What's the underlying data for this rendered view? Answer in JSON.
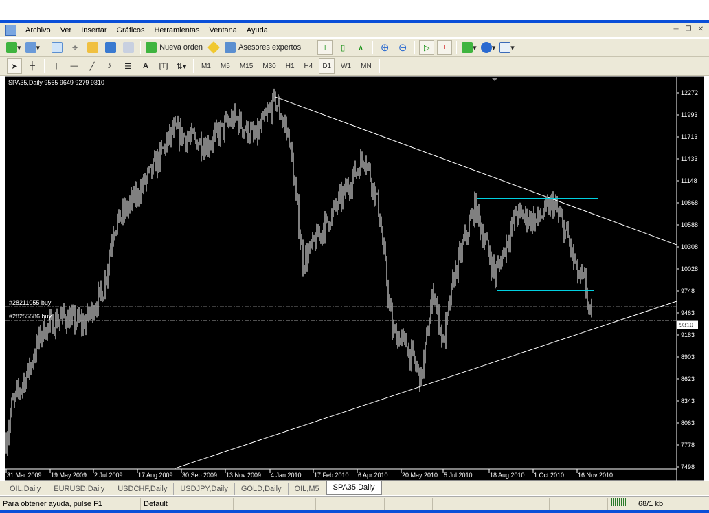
{
  "menu": [
    "Archivo",
    "Ver",
    "Insertar",
    "Gráficos",
    "Herramientas",
    "Ventana",
    "Ayuda"
  ],
  "toolbar": {
    "new_order": "Nueva orden",
    "experts": "Asesores expertos"
  },
  "timeframes": [
    "M1",
    "M5",
    "M15",
    "M30",
    "H1",
    "H4",
    "D1",
    "W1",
    "MN"
  ],
  "active_timeframe": "D1",
  "chart": {
    "header": "SPA35,Daily  9565 9649 9279 9310",
    "price_labels": [
      "12272",
      "11993",
      "11713",
      "11433",
      "11148",
      "10868",
      "10588",
      "10308",
      "10028",
      "9748",
      "9463",
      "9183",
      "8903",
      "8623",
      "8343",
      "8063",
      "7778",
      "7498"
    ],
    "current_price": "9310",
    "date_labels": [
      "31 Mar 2009",
      "19 May 2009",
      "2 Jul 2009",
      "17 Aug 2009",
      "30 Sep 2009",
      "13 Nov 2009",
      "4 Jan 2010",
      "17 Feb 2010",
      "6 Apr 2010",
      "20 May 2010",
      "5 Jul 2010",
      "18 Aug 2010",
      "1 Oct 2010",
      "16 Nov 2010"
    ],
    "orders": [
      {
        "label": "#28211055 buy",
        "price": 9542
      },
      {
        "label": "#28255586 buy",
        "price": 9367
      }
    ],
    "colors": {
      "bars": "#ffffff",
      "trend": "#ffffff",
      "level": "#00d0e0",
      "order": "#a0a0a0"
    }
  },
  "chart_data": {
    "type": "ohlc",
    "symbol": "SPA35",
    "timeframe": "Daily",
    "ylim": [
      7498,
      12272
    ],
    "close_path": [
      [
        0,
        7832
      ],
      [
        4,
        8270
      ],
      [
        16,
        8710
      ],
      [
        26,
        9235
      ],
      [
        41,
        9410
      ],
      [
        56,
        9323
      ],
      [
        71,
        9762
      ],
      [
        78,
        10552
      ],
      [
        96,
        10990
      ],
      [
        111,
        11430
      ],
      [
        121,
        11780
      ],
      [
        146,
        11605
      ],
      [
        166,
        11956
      ],
      [
        181,
        11693
      ],
      [
        196,
        12175
      ],
      [
        206,
        11693
      ],
      [
        216,
        10113
      ],
      [
        231,
        10552
      ],
      [
        246,
        10990
      ],
      [
        261,
        11473
      ],
      [
        271,
        10815
      ],
      [
        281,
        9235
      ],
      [
        291,
        9060
      ],
      [
        302,
        8621
      ],
      [
        311,
        9762
      ],
      [
        318,
        9060
      ],
      [
        326,
        9937
      ],
      [
        341,
        10815
      ],
      [
        356,
        9937
      ],
      [
        371,
        10727
      ],
      [
        386,
        10640
      ],
      [
        398,
        10859
      ],
      [
        408,
        10464
      ],
      [
        416,
        9937
      ],
      [
        421,
        9850
      ],
      [
        426,
        9310
      ]
    ],
    "trendlines": [
      {
        "from": [
          196,
          12219
        ],
        "to": [
          488,
          10332
        ]
      },
      {
        "from": [
          123,
          7481
        ],
        "to": [
          488,
          9613
        ]
      }
    ],
    "levels": [
      {
        "price": 10920,
        "from": 343,
        "to": 431
      },
      {
        "price": 9753,
        "from": 357,
        "to": 428
      }
    ]
  },
  "tabs": [
    "OIL,Daily",
    "EURUSD,Daily",
    "USDCHF,Daily",
    "USDJPY,Daily",
    "GOLD,Daily",
    "OIL,M5",
    "SPA35,Daily"
  ],
  "active_tab": "SPA35,Daily",
  "status": {
    "help": "Para obtener ayuda, pulse F1",
    "profile": "Default",
    "traffic": "68/1 kb"
  }
}
